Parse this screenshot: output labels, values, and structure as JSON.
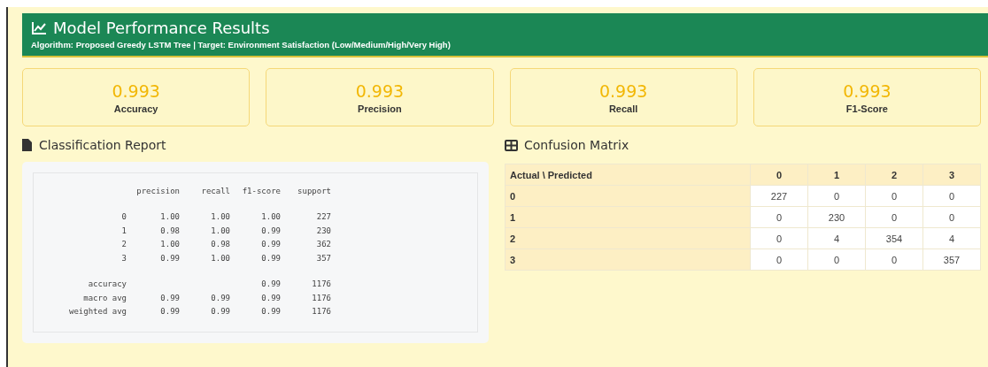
{
  "header": {
    "title": "Model Performance Results",
    "subtitle": "Algorithm: Proposed Greedy LSTM Tree | Target: Environment Satisfaction (Low/Medium/High/Very High)"
  },
  "metrics": [
    {
      "value": "0.993",
      "label": "Accuracy"
    },
    {
      "value": "0.993",
      "label": "Precision"
    },
    {
      "value": "0.993",
      "label": "Recall"
    },
    {
      "value": "0.993",
      "label": "F1-Score"
    }
  ],
  "classification_report": {
    "title": "Classification Report",
    "columns": [
      "precision",
      "recall",
      "f1-score",
      "support"
    ],
    "class_rows": [
      {
        "label": "0",
        "precision": "1.00",
        "recall": "1.00",
        "f1": "1.00",
        "support": "227"
      },
      {
        "label": "1",
        "precision": "0.98",
        "recall": "1.00",
        "f1": "0.99",
        "support": "230"
      },
      {
        "label": "2",
        "precision": "1.00",
        "recall": "0.98",
        "f1": "0.99",
        "support": "362"
      },
      {
        "label": "3",
        "precision": "0.99",
        "recall": "1.00",
        "f1": "0.99",
        "support": "357"
      }
    ],
    "summary_rows": [
      {
        "label": "accuracy",
        "f1": "0.99",
        "support": "1176"
      },
      {
        "label": "macro avg",
        "precision": "0.99",
        "recall": "0.99",
        "f1": "0.99",
        "support": "1176"
      },
      {
        "label": "weighted avg",
        "precision": "0.99",
        "recall": "0.99",
        "f1": "0.99",
        "support": "1176"
      }
    ]
  },
  "confusion_matrix": {
    "title": "Confusion Matrix",
    "corner": "Actual \\ Predicted",
    "columns": [
      "0",
      "1",
      "2",
      "3"
    ],
    "rows": [
      {
        "label": "0",
        "values": [
          "227",
          "0",
          "0",
          "0"
        ]
      },
      {
        "label": "1",
        "values": [
          "0",
          "230",
          "0",
          "0"
        ]
      },
      {
        "label": "2",
        "values": [
          "0",
          "4",
          "354",
          "4"
        ]
      },
      {
        "label": "3",
        "values": [
          "0",
          "0",
          "0",
          "357"
        ]
      }
    ]
  }
}
